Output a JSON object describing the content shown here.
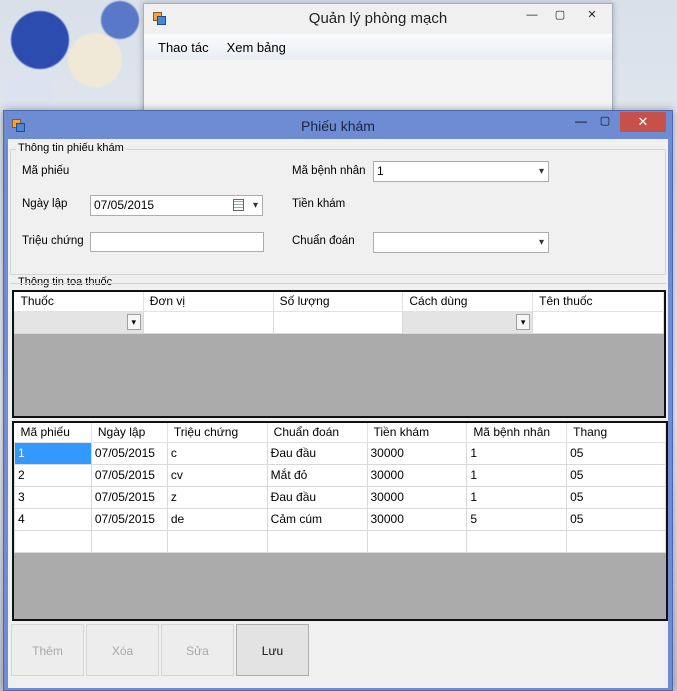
{
  "main_window": {
    "title": "Quản lý phòng mạch",
    "menu": [
      "Thao tác",
      "Xem bảng"
    ],
    "min_glyph": "—",
    "max_glyph": "▢",
    "close_glyph": "✕"
  },
  "child_window": {
    "title": "Phiếu khám",
    "min_glyph": "—",
    "max_glyph": "▢",
    "close_glyph": "✕"
  },
  "form": {
    "group1_title": "Thông tin phiếu khám",
    "ma_phieu_label": "Mã phiếu",
    "ngay_lap_label": "Ngày lập",
    "ngay_lap_value": "07/05/2015",
    "trieu_chung_label": "Triệu chứng",
    "trieu_chung_value": "",
    "ma_benh_nhan_label": "Mã bệnh nhân",
    "ma_benh_nhan_value": "1",
    "tien_kham_label": "Tiền khám",
    "chuan_doan_label": "Chuẩn đoán",
    "chuan_doan_value": "",
    "group2_title": "Thông tin toa thuốc"
  },
  "prescription_grid": {
    "columns": [
      "Thuốc",
      "Đơn vị",
      "Số lượng",
      "Cách dùng",
      "Tên thuốc"
    ]
  },
  "records_grid": {
    "columns": [
      "Mã phiếu",
      "Ngày lập",
      "Triệu chứng",
      "Chuẩn đoán",
      "Tiền khám",
      "Mã bệnh nhân",
      "Thang"
    ],
    "rows": [
      [
        "1",
        "07/05/2015",
        "c",
        "Đau đầu",
        "30000",
        "1",
        "05"
      ],
      [
        "2",
        "07/05/2015",
        "cv",
        "Mắt đỏ",
        "30000",
        "1",
        "05"
      ],
      [
        "3",
        "07/05/2015",
        "z",
        "Đau đầu",
        "30000",
        "1",
        "05"
      ],
      [
        "4",
        "07/05/2015",
        "de",
        "Cảm cúm",
        "30000",
        "5",
        "05"
      ]
    ]
  },
  "buttons": {
    "them": "Thêm",
    "xoa": "Xóa",
    "sua": "Sửa",
    "luu": "Lưu"
  },
  "colors": {
    "child_frame": "#6d8cd4",
    "close_button": "#c7504a",
    "selection": "#3399ff"
  },
  "icons": [
    "app-icon",
    "calendar-icon",
    "dropdown-arrow-icon"
  ]
}
